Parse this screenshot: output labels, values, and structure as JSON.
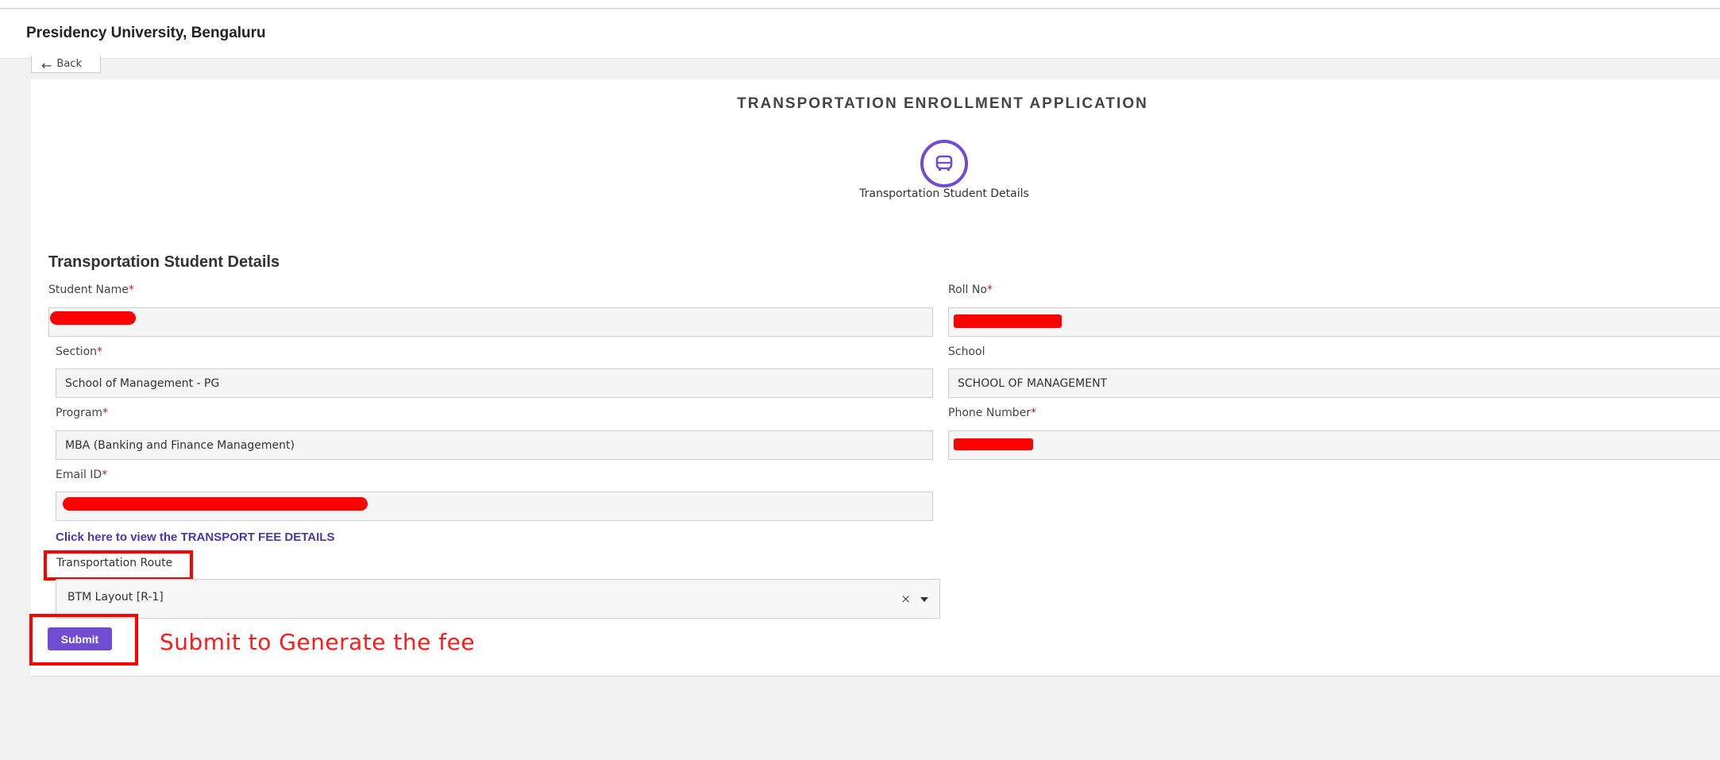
{
  "app": {
    "title": "Presidency University, Bengaluru"
  },
  "back_button": {
    "label": "Back",
    "icon": "arrow-left-icon"
  },
  "form": {
    "title": "TRANSPORTATION ENROLLMENT APPLICATION",
    "step": {
      "icon": "bus-icon",
      "label": "Transportation Student Details",
      "accent_color": "#6f4cd1"
    },
    "section_heading": "Transportation Student Details",
    "fields": {
      "student_name": {
        "label": "Student Name",
        "value": ""
      },
      "roll_no": {
        "label": "Roll No",
        "value": ""
      },
      "section": {
        "label": "Section",
        "value": "School of Management - PG"
      },
      "school": {
        "label": "School",
        "value": "SCHOOL OF MANAGEMENT"
      },
      "program": {
        "label": "Program",
        "value": "MBA (Banking and Finance Management)"
      },
      "phone_number": {
        "label": "Phone Number",
        "value": ""
      },
      "email_id": {
        "label": "Email ID",
        "value": ""
      }
    },
    "required_marker": "*",
    "fee_link": "Click here to view the TRANSPORT FEE DETAILS",
    "route": {
      "label": "Transportation Route",
      "selected": "BTM Layout [R-1]",
      "clear_symbol": "×"
    },
    "submit_label": "Submit"
  },
  "annotation": {
    "text": "Submit to Generate the fee",
    "color": "#ff0000"
  }
}
